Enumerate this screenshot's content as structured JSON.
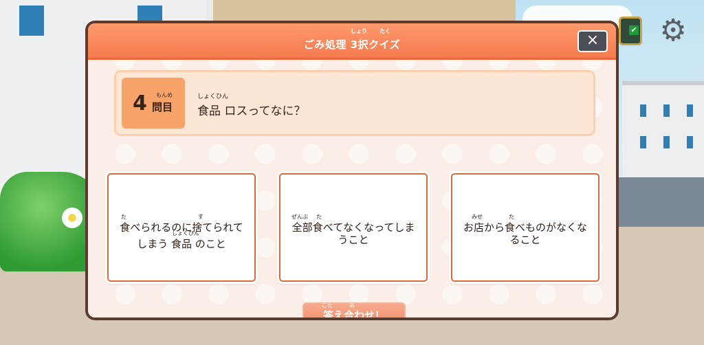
{
  "dialog": {
    "title": "ごみ処理 3択クイズ",
    "title_ruby_1": "しょり",
    "title_ruby_2": "たく",
    "close_label": "×"
  },
  "question": {
    "number": "4",
    "unit": "問目",
    "unit_ruby": "もんめ",
    "text": "食品 ロスってなに？",
    "text_ruby": "しょくひん"
  },
  "answers": [
    {
      "text_1": "食べられるのに捨てられて",
      "text_2": "しまう 食品 のこと",
      "ruby_1": "た",
      "ruby_2": "す",
      "ruby_3": "しょくひん"
    },
    {
      "text_1": "全部食べてなくなってしま",
      "text_2": "うこと",
      "ruby_1": "ぜんぶ",
      "ruby_2": "た"
    },
    {
      "text_1": "お店から食べものがなくな",
      "text_2": "ること",
      "ruby_1": "みせ",
      "ruby_2": "た"
    }
  ],
  "check_button": {
    "label": "答え合わせ！",
    "ruby_1": "こた",
    "ruby_2": "あ"
  },
  "hud": {
    "list_check": "✔",
    "gear": "⚙"
  },
  "colors": {
    "header": "#f47b4e",
    "answer_border": "#d96b3f",
    "question_bg": "#fde6d4",
    "number_bg": "#f8a36a"
  }
}
